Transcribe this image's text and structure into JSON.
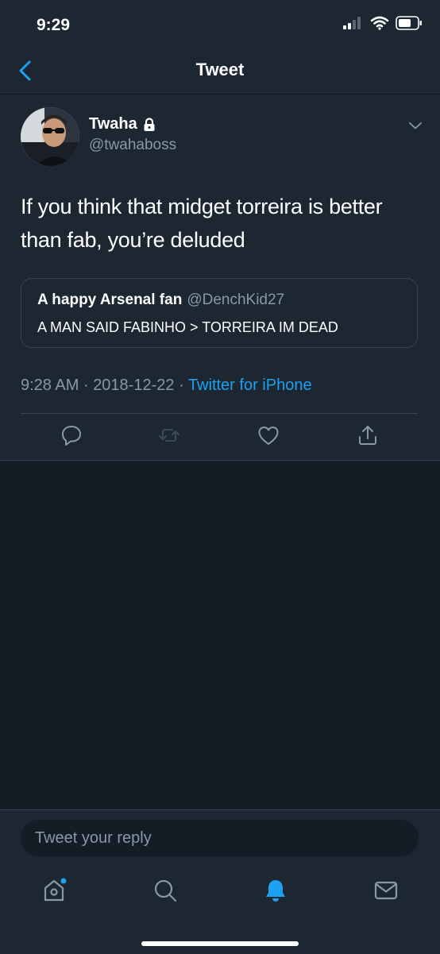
{
  "status_bar": {
    "time": "9:29"
  },
  "nav": {
    "title": "Tweet",
    "back_icon": "chevron-left-icon"
  },
  "tweet": {
    "author_name": "Twaha",
    "author_handle": "@twahaboss",
    "protected": true,
    "text": "If you think that midget torreira is better than fab, you’re deluded",
    "quoted": {
      "name": "A happy Arsenal fan",
      "handle": "@DenchKid27",
      "text": "A MAN SAID FABINHO > TORREIRA IM DEAD"
    },
    "time": "9:28 AM",
    "date": "2018-12-22",
    "separator": "·",
    "source": "Twitter for iPhone",
    "actions": [
      "reply-icon",
      "retweet-icon",
      "like-icon",
      "share-icon"
    ]
  },
  "reply": {
    "placeholder": "Tweet your reply"
  },
  "tabs": [
    "home-icon",
    "search-icon",
    "notifications-icon",
    "messages-icon"
  ],
  "colors": {
    "background": "#141d26",
    "surface": "#1c2732",
    "accent": "#1da1f2",
    "muted": "#8899a6",
    "border": "#38444d"
  }
}
